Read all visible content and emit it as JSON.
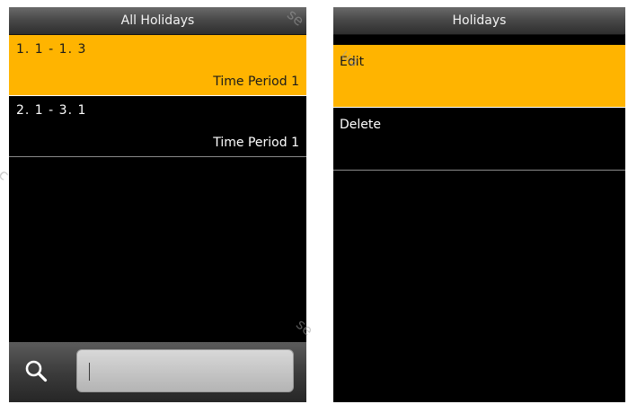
{
  "left_screen": {
    "title": "All Holidays",
    "rows": [
      {
        "date": "1. 1 -  1. 3",
        "period": "Time Period 1",
        "selected": true
      },
      {
        "date": "2. 1 -  3. 1",
        "period": "Time Period 1",
        "selected": false
      }
    ],
    "search": {
      "icon": "search-icon",
      "value": ""
    }
  },
  "right_screen": {
    "title": "Holidays",
    "menu": [
      {
        "label": "Edit",
        "selected": true
      },
      {
        "label": "Delete",
        "selected": false
      }
    ]
  },
  "colors": {
    "selected_row": "#ffb400",
    "screen_bg": "#000000",
    "divider": "#8a8a8a"
  }
}
